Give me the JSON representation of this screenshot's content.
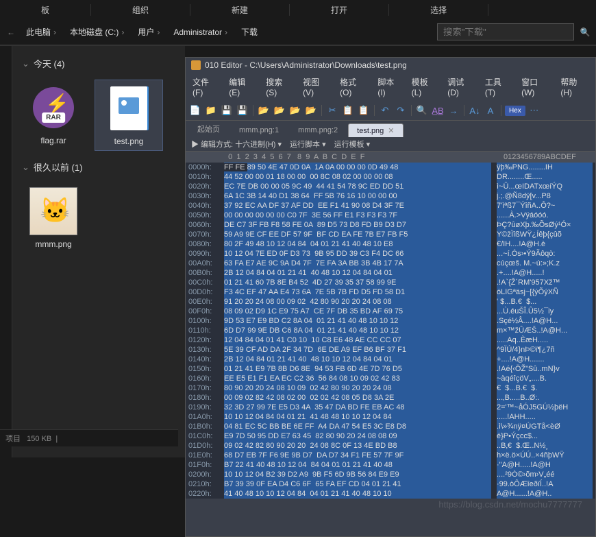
{
  "ribbon": {
    "groups": [
      "组织",
      "新建",
      "打开",
      "选择"
    ],
    "partial_labels": [
      "板"
    ]
  },
  "breadcrumb": {
    "items": [
      "此电脑",
      "本地磁盘 (C:)",
      "用户",
      "Administrator",
      "下载"
    ],
    "search_placeholder": "搜索\"下载\""
  },
  "explorer": {
    "groups": [
      {
        "label": "今天 (4)",
        "files": [
          {
            "name": "flag.rar",
            "type": "rar",
            "selected": false
          },
          {
            "name": "test.png",
            "type": "png",
            "selected": true
          }
        ]
      },
      {
        "label": "很久以前 (1)",
        "files": [
          {
            "name": "mmm.png",
            "type": "thumb",
            "selected": false
          }
        ]
      }
    ]
  },
  "status": {
    "items_text": "项目",
    "size": "150 KB"
  },
  "editor": {
    "title": "010 Editor - C:\\Users\\Administrator\\Downloads\\test.png",
    "menus": [
      "文件(F)",
      "编辑(E)",
      "搜索(S)",
      "视图(V)",
      "格式(O)",
      "脚本(I)",
      "模板(L)",
      "调试(D)",
      "工具(T)",
      "窗口(W)",
      "帮助(H)"
    ],
    "tabs": [
      {
        "label": "起始页",
        "active": false,
        "closable": false
      },
      {
        "label": "mmm.png:1",
        "active": false,
        "closable": false
      },
      {
        "label": "mmm.png:2",
        "active": false,
        "closable": false
      },
      {
        "label": "test.png",
        "active": true,
        "closable": true
      }
    ],
    "sub": {
      "edit_mode_label": "编辑方式:",
      "edit_mode_value": "十六进制(H)",
      "run_script": "运行脚本",
      "run_template": "运行模板"
    },
    "hex_btn": "Hex",
    "col_header_hex": "  0  1  2  3  4  5  6  7   8  9  A  B  C  D  E  F",
    "col_header_ascii": "0123456789ABCDEF",
    "rows": [
      {
        "o": "0000h:",
        "h": "FF FE 89 50 4E 47 0D 0A  1A 0A 00 00 00 0D 49 48",
        "a": "ÿþ‰PNG........IH"
      },
      {
        "o": "0010h:",
        "h": "44 52 00 00 01 18 00 00  00 8C 08 02 00 00 00 08",
        "a": "DR........Œ....."
      },
      {
        "o": "0020h:",
        "h": "EC 7E DB 00 00 05 9C 49  44 41 54 78 9C ED DD 51",
        "a": "ì~Û...œIDATxœíÝQ"
      },
      {
        "o": "0030h:",
        "h": "6A 1C 3B 14 40 D1 38 64  FF 5B 76 16 10 00 00 00",
        "a": "j.;.@Ñ8dÿ[v...P8"
      },
      {
        "o": "0040h:",
        "h": "37 92 EC AA DF 37 AF DD  EE F1 41 90 08 D4 3F 7E",
        "a": "7'ìªß7¯ÝîñA..Ô?~"
      },
      {
        "o": "0050h:",
        "h": "00 00 00 00 00 00 C0 7F  3E 56 FF E1 F3 F3 F3 7F",
        "a": "......À.>Vÿáóóó."
      },
      {
        "o": "0060h:",
        "h": "DE C7 3F FB F8 58 FE 0A  89 D5 73 D8 FD B9 D3 D7",
        "a": "ÞÇ?ûøXþ.‰ÕsØý¹Ó×"
      },
      {
        "o": "0070h:",
        "h": "59 A9 9E CF EE DF 57 9F  BF CD EA FE 7B E7 FB F5",
        "a": "Y©žÏîßWŸ¿Íêþ{çûõ"
      },
      {
        "o": "0080h:",
        "h": "80 2F 49 48 10 12 04 84  04 01 21 41 40 48 10 E8",
        "a": "€/IH....!A@H.è"
      },
      {
        "o": "0090h:",
        "h": "10 12 04 7E ED 0F D3 73  9B 95 DD 39 C3 F4 DC 66",
        "a": "...~í.Ós›•Ý9Ãôqò:"
      },
      {
        "o": "00A0h:",
        "h": "63 FA E7 AE 9C 9A D4 7F  7E FA 3A BB 3B 4B 17 7A",
        "a": "cúçœš. M.~ú:»;K.z"
      },
      {
        "o": "00B0h:",
        "h": "2B 12 04 84 04 01 21 41  40 48 10 12 04 84 04 01",
        "a": ".+....!A@H.....!"
      },
      {
        "o": "00C0h:",
        "h": "01 21 41 60 7B 8E B4 52  4D 27 39 35 37 58 99 9E",
        "a": ".!A`{Ž´RM'957Xž™"
      },
      {
        "o": "00D0h:",
        "h": "F3 4C EF 47 AA E4 73 6A  7E 5B 7B FD D5 FD 58 D1",
        "a": "óLïGªäsj~[{ýÕýXÑ"
      },
      {
        "o": "00E0h:",
        "h": "91 20 20 24 08 00 09 02  42 80 90 20 20 24 08 08",
        "a": "' $...B.€  $..."
      },
      {
        "o": "00F0h:",
        "h": "08 09 02 D9 1C E9 75 A7  CE 7F DB 35 BD AF 69 75",
        "a": "...Ù.éuŠÎ.Û5½¯iy"
      },
      {
        "o": "0100h:",
        "h": "9D 53 E7 E9 BD C2 8A 04  01 21 41 40 48 10 10 12",
        "a": ".Sçé½Â....!A@H..."
      },
      {
        "o": "0110h:",
        "h": "6D D7 99 9E DB C6 8A 04  01 21 41 40 48 10 10 12",
        "a": "m×™žÛÆŠ..!A@H..."
      },
      {
        "o": "0120h:",
        "h": "12 04 84 04 01 41 C0 10  10 C8 E6 48 AE CC CC 07",
        "a": ".....Aq..ÈæH....."
      },
      {
        "o": "0130h:",
        "h": "5E 39 CF AD DA 2F 34 7D  6E DE A9 EF B6 BF 37 F1",
        "a": "^9Ï­Ú/4}nÞ©ï¶¿7ñ"
      },
      {
        "o": "0140h:",
        "h": "2B 12 04 84 01 21 41 40  48 10 10 12 04 84 04 01",
        "a": "+....!A@H......."
      },
      {
        "o": "0150h:",
        "h": "01 21 41 E9 7B 8B D6 8E  94 53 FB 6D 4E 7D 76 D5",
        "a": ".!Aé{‹ÖŽ”Sû..mN}v"
      },
      {
        "o": "0160h:",
        "h": "EE E5 E1 F1 EA EC C2 36  56 84 08 10 09 02 42 83",
        "a": "~àqéîçöV„....B."
      },
      {
        "o": "0170h:",
        "h": "80 90 20 20 24 08 10 09  02 42 80 90 20 20 24 08",
        "a": "€  $...B.€  $."
      },
      {
        "o": "0180h:",
        "h": "00 09 02 82 42 08 02 00  02 02 42 08 05 D8 3A 2E",
        "a": "...‚B.....B..Ø:."
      },
      {
        "o": "0190h:",
        "h": "32 3D 27 99 7E E5 D3 4A  35 47 DA BD FE EB AC 48",
        "a": "2='™~åÓJ5GÚ½þëH"
      },
      {
        "o": "01A0h:",
        "h": "10 10 12 04 84 04 01 21  41 48 48 10 10 12 04 84",
        "a": ".....!AHH....."
      },
      {
        "o": "01B0h:",
        "h": "04 81 EC 5C BB BE 6E FF  A4 DA 47 54 E5 3C E8 D8",
        "a": ".ì\\»¾nÿ¤ÚGTå<èØ"
      },
      {
        "o": "01C0h:",
        "h": "E9 7D 50 95 DD E7 63 45  82 80 90 20 24 08 08 09",
        "a": "é}P•Ýçcc$..."
      },
      {
        "o": "01D0h:",
        "h": "09 02 42 82 80 90 20 20  24 08 8C 0F 13 4E BD B8",
        "a": "..B‚€  $.Œ..N½¸"
      },
      {
        "o": "01E0h:",
        "h": "68 D7 EB 7F F6 9E 9B D7  DA D7 34 F1 FE 57 7F 9F",
        "a": "h×ë.ö×ÚÚ..×4ñþWŸ"
      },
      {
        "o": "01F0h:",
        "h": "B7 22 41 40 48 10 12 04  84 04 01 01 21 41 40 48",
        "a": "·\"A@H.....!A@H"
      },
      {
        "o": "0200h:",
        "h": "10 10 12 04 B2 39 D2 A9  9B F5 6D 9B 56 84 E9 E9",
        "a": "....²9Ò©›õm›V„éé"
      },
      {
        "o": "0210h:",
        "h": "B7 39 39 0F EA D4 C6 6F  65 FA EF CD 04 01 21 41",
        "a": "·99.òÔÆîeðïÍ..!A"
      },
      {
        "o": "0220h:",
        "h": "41 40 48 10 10 12 04 84  04 01 21 41 40 48 10 10",
        "a": "A@H......!A@H.."
      }
    ]
  },
  "watermark": "https://blog.csdn.net/mochu7777777"
}
